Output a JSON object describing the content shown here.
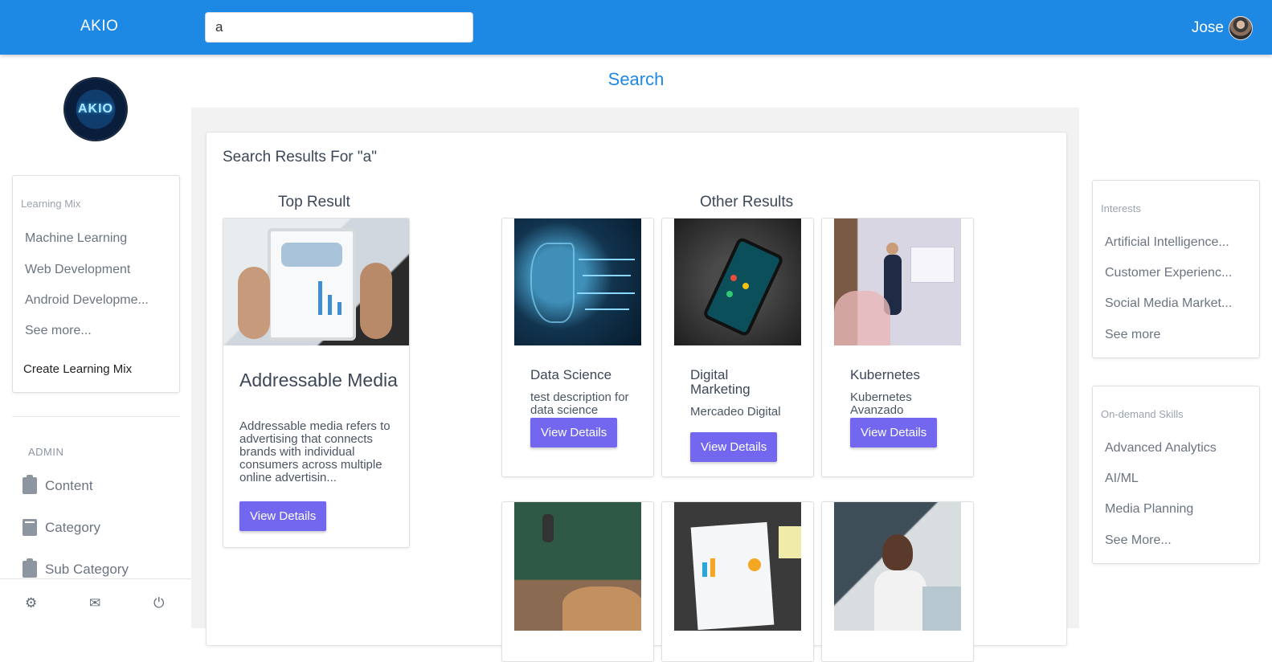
{
  "header": {
    "brand": "AKIO",
    "search_value": "a",
    "user_name": "Jose",
    "colors": {
      "topbar": "#1e88e5",
      "accent_button": "#7367f0"
    }
  },
  "sidebar": {
    "logo_text": "AKIO",
    "learning_mix": {
      "heading": "Learning Mix",
      "items": [
        "Machine Learning",
        "Web Development",
        "Android Developme...",
        "See more..."
      ],
      "create_label": "Create Learning Mix"
    },
    "admin": {
      "heading": "ADMIN",
      "items": [
        {
          "label": "Content",
          "icon": "clipboard-copy-icon"
        },
        {
          "label": "Category",
          "icon": "book-icon"
        },
        {
          "label": "Sub Category",
          "icon": "clipboard-icon"
        }
      ]
    },
    "footer_icons": [
      "gear-icon",
      "mail-icon",
      "power-icon"
    ]
  },
  "main": {
    "page_title": "Search",
    "results_heading": "Search Results For \"a\"",
    "top_result_heading": "Top Result",
    "other_results_heading": "Other Results",
    "top_result": {
      "title": "Addressable Media",
      "description": "Addressable media refers to advertising that connects brands with individual consumers across multiple online advertisin...",
      "button": "View Details",
      "image": "tablet-world-map-image"
    },
    "other_results": [
      {
        "title": "Data Science",
        "description": "test description for data science",
        "button": "View Details",
        "image": "ai-head-image"
      },
      {
        "title": "Digital Marketing",
        "description": "Mercadeo Digital",
        "button": "View Details",
        "image": "smartphone-map-image"
      },
      {
        "title": "Kubernetes",
        "description": "Kubernetes Avanzado",
        "button": "View Details",
        "image": "presenter-image"
      }
    ],
    "more_result_images": [
      "classroom-image",
      "charts-paper-image",
      "woman-phone-image"
    ]
  },
  "right_sidebar": {
    "interests": {
      "heading": "Interests",
      "items": [
        "Artificial Intelligence...",
        "Customer Experienc...",
        "Social Media Market...",
        "See more"
      ]
    },
    "skills": {
      "heading": "On-demand Skills",
      "items": [
        "Advanced Analytics",
        "AI/ML",
        "Media Planning",
        "See More..."
      ]
    }
  }
}
